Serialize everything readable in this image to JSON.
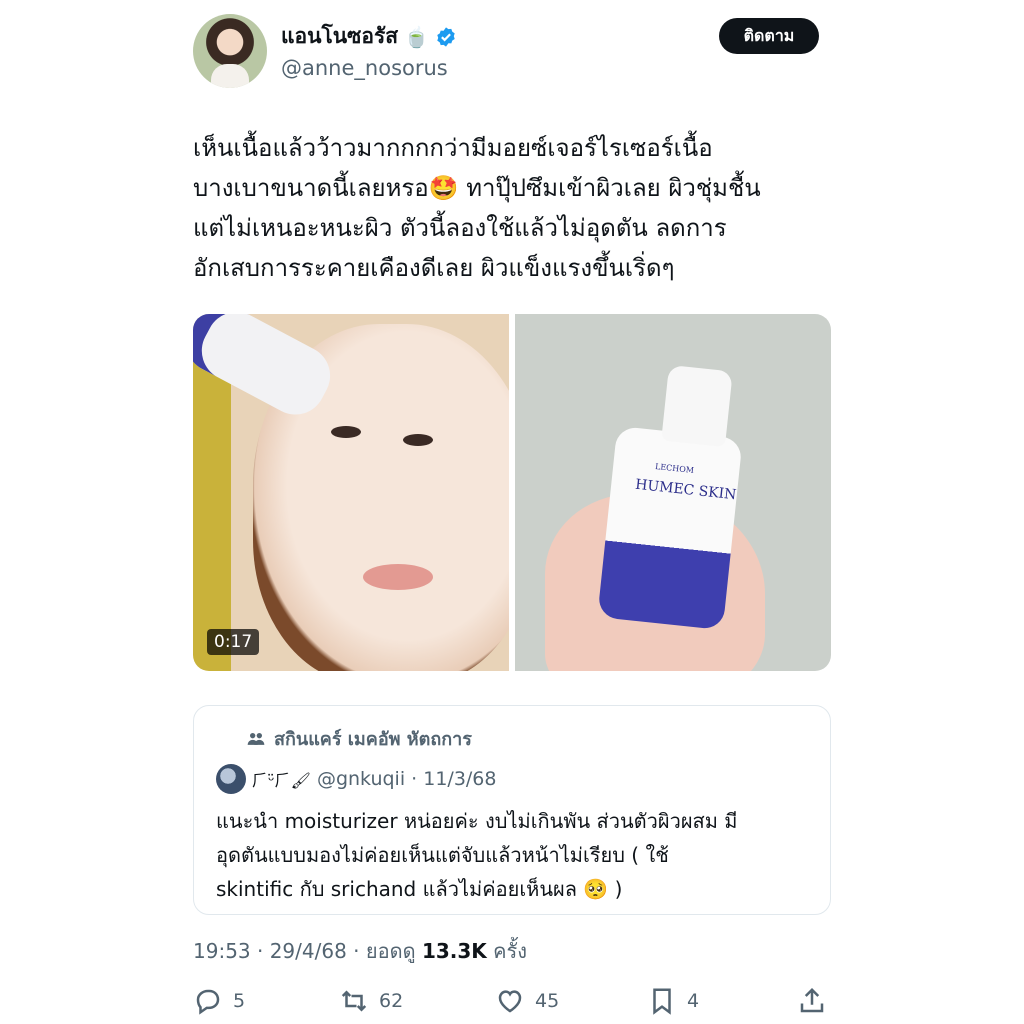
{
  "author": {
    "display_name": "แอนโนซอรัส",
    "name_emoji": "🍵",
    "handle": "@anne_nosorus",
    "verified": true,
    "follow_label": "ติดตาม"
  },
  "tweet": {
    "lines": [
      "เห็นเนื้อแล้วว้าวมากกกกว่ามีมอยซ์เจอร์ไรเซอร์เนื้อ",
      "บางเบาขนาดนี้เลยหรอ🤩 ทาปุ๊ปซึมเข้าผิวเลย ผิวชุ่มชื้น",
      "แต่ไม่เหนอะหนะผิว ตัวนี้ลองใช้แล้วไม่อุดตัน ลดการ",
      "อักเสบการระคายเคืองดีเลย ผิวแข็งแรงขึ้นเริ่ดๆ"
    ]
  },
  "media": {
    "video_duration": "0:17",
    "product_brand_small": "LECHOM",
    "product_brand": "HUMEC SKIN"
  },
  "quote": {
    "community": "สกินแคร์ เมคอัพ หัตถการ",
    "display_name": "⺁ᵕ̈⺁🖌",
    "handle_date": "@gnkuqii · 11/3/68",
    "lines": [
      "แนะนำ moisturizer หน่อยค่ะ งบไม่เกินพัน ส่วนตัวผิวผสม มี",
      "อุดตันแบบมองไม่ค่อยเห็นแต่จับแล้วหน้าไม่เรียบ ( ใช้",
      "skintific กับ srichand แล้วไม่ค่อยเห็นผล 🥺 )"
    ]
  },
  "meta": {
    "time_date": "19:53 · 29/4/68 · ยอดดู ",
    "views": "13.3K",
    "views_suffix": " ครั้ง"
  },
  "actions": {
    "replies": "5",
    "retweets": "62",
    "likes": "45",
    "bookmarks": "4"
  },
  "colors": {
    "verified": "#1d9bf0",
    "text": "#0f1419",
    "secondary": "#536471"
  }
}
